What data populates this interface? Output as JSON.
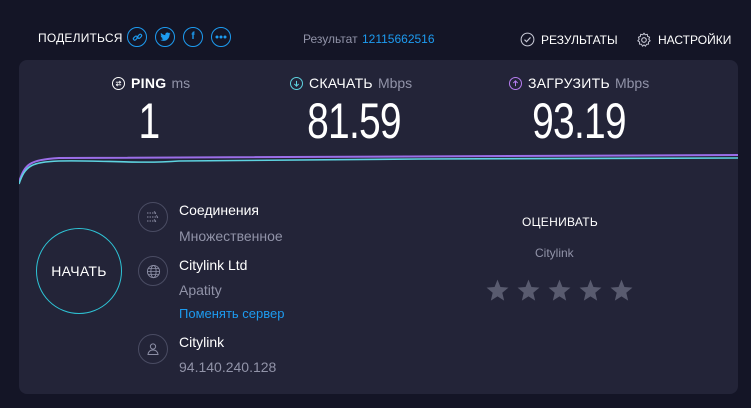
{
  "topbar": {
    "share_label": "ПОДЕЛИТЬСЯ",
    "share_buttons": [
      {
        "name": "link-icon"
      },
      {
        "name": "twitter-icon"
      },
      {
        "name": "facebook-icon",
        "glyph": "f"
      },
      {
        "name": "more-icon"
      }
    ],
    "result_label": "Результат",
    "result_id": "12115662516",
    "results_label": "РЕЗУЛЬТАТЫ",
    "settings_label": "НАСТРОЙКИ"
  },
  "metrics": {
    "ping": {
      "label": "PING",
      "unit": "ms",
      "value": "1",
      "color": "#ffffff"
    },
    "download": {
      "label": "СКАЧАТЬ",
      "unit": "Mbps",
      "value": "81.59",
      "color": "#5ed3e0"
    },
    "upload": {
      "label": "ЗАГРУЗИТЬ",
      "unit": "Mbps",
      "value": "93.19",
      "color": "#b67df0"
    }
  },
  "start_button": "НАЧАТЬ",
  "connection": {
    "title": "Соединения",
    "value": "Множественное"
  },
  "server": {
    "isp": "Citylink Ltd",
    "city": "Apatity",
    "change_link": "Поменять сервер"
  },
  "user": {
    "isp": "Citylink",
    "ip": "94.140.240.128"
  },
  "rating": {
    "title": "ОЦЕНИВАТЬ",
    "isp": "Citylink",
    "stars_total": 5,
    "stars_filled": 0
  },
  "colors": {
    "accent": "#1d9bf0",
    "background": "#141526",
    "panel": "#232438",
    "download_line": "#5ed3e0",
    "upload_line": "#9b6ee8"
  }
}
